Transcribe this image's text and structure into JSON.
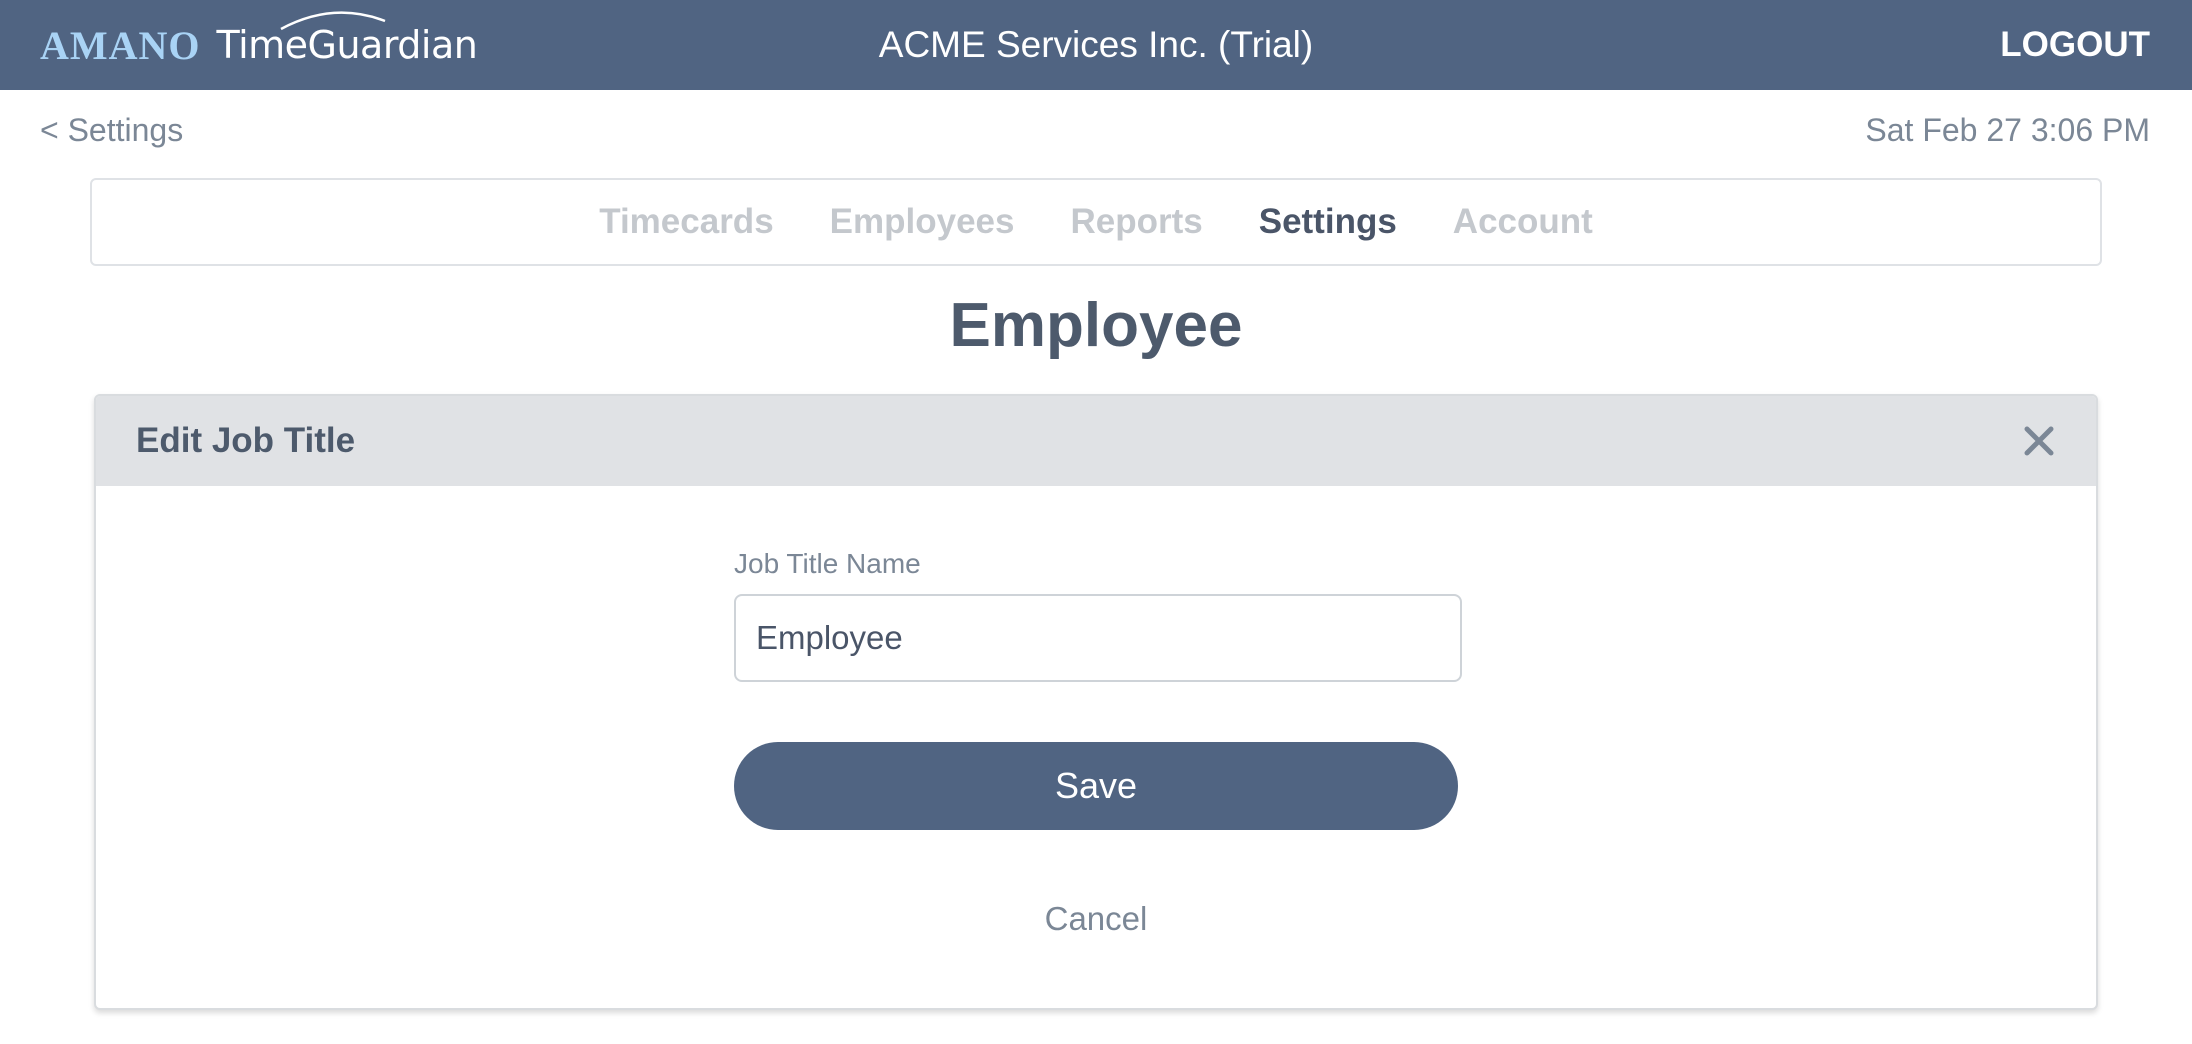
{
  "header": {
    "logo_brand": "AMANO",
    "logo_product": "TimeGuardian",
    "company_name": "ACME Services Inc. (Trial)",
    "logout_label": "LOGOUT"
  },
  "subheader": {
    "back_label": "< Settings",
    "datetime": "Sat Feb 27 3:06 PM"
  },
  "nav": {
    "tabs": [
      {
        "label": "Timecards",
        "active": false
      },
      {
        "label": "Employees",
        "active": false
      },
      {
        "label": "Reports",
        "active": false
      },
      {
        "label": "Settings",
        "active": true
      },
      {
        "label": "Account",
        "active": false
      }
    ]
  },
  "page": {
    "title": "Employee"
  },
  "modal": {
    "title": "Edit Job Title",
    "close_icon": "close-icon",
    "field_label": "Job Title Name",
    "field_value": "Employee",
    "save_label": "Save",
    "cancel_label": "Cancel"
  },
  "colors": {
    "header_bg": "#506482",
    "logo_accent": "#a9d3f5",
    "active_tab": "#4a5568",
    "inactive_tab": "#c4c8cd",
    "modal_header_bg": "#e0e2e5",
    "primary_button": "#506482"
  }
}
